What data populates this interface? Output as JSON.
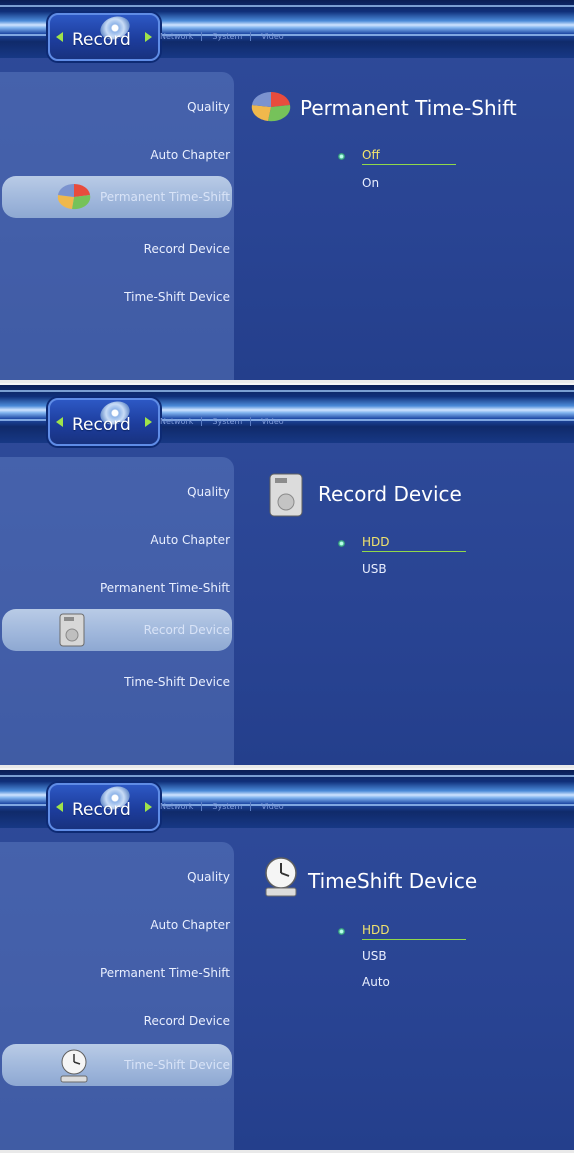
{
  "header": {
    "active_tab": "Record",
    "tabs": [
      "Network",
      "System",
      "Video"
    ]
  },
  "menu_items": [
    "Quality",
    "Auto Chapter",
    "Permanent Time-Shift",
    "Record Device",
    "Time-Shift Device"
  ],
  "screens": [
    {
      "selected_menu": "Permanent Time-Shift",
      "title": "Permanent Time-Shift",
      "icon": "pie-chart-icon",
      "options": [
        "Off",
        "On"
      ],
      "selected_option": "Off"
    },
    {
      "selected_menu": "Record Device",
      "title": "Record Device",
      "icon": "hard-drive-icon",
      "options": [
        "HDD",
        "USB"
      ],
      "selected_option": "HDD"
    },
    {
      "selected_menu": "Time-Shift Device",
      "title": "TimeShift Device",
      "icon": "clock-drive-icon",
      "options": [
        "HDD",
        "USB",
        "Auto"
      ],
      "selected_option": "HDD"
    }
  ],
  "colors": {
    "background": "#294493",
    "highlight": "#f2e46d",
    "underline": "#91d84a",
    "menu_text": "#e9efff"
  }
}
